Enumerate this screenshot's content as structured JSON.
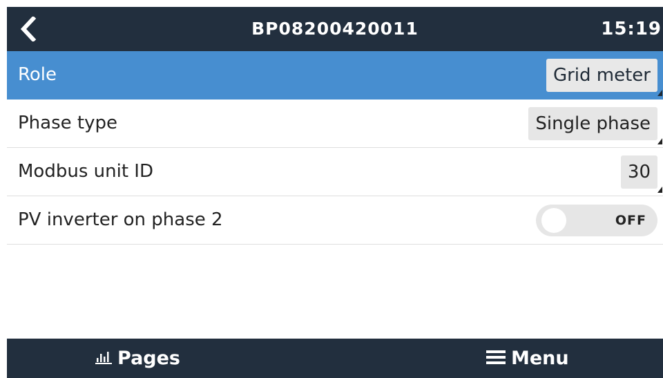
{
  "header": {
    "back_icon": "chevron-left-icon",
    "title": "BP08200420011",
    "clock": "15:19"
  },
  "settings": [
    {
      "label": "Role",
      "value": "Grid meter",
      "selected": true
    },
    {
      "label": "Phase type",
      "value": "Single phase"
    },
    {
      "label": "Modbus unit ID",
      "value": "30"
    },
    {
      "label": "PV inverter on phase 2",
      "toggle_state": "OFF"
    }
  ],
  "footer": {
    "pages_icon": "bar-chart-icon",
    "pages_label": "Pages",
    "menu_icon": "hamburger-menu-icon",
    "menu_label": "Menu"
  },
  "colors": {
    "header_bg": "#222f3e",
    "selected_row": "#478ed0",
    "value_box": "#e6e6e6"
  }
}
